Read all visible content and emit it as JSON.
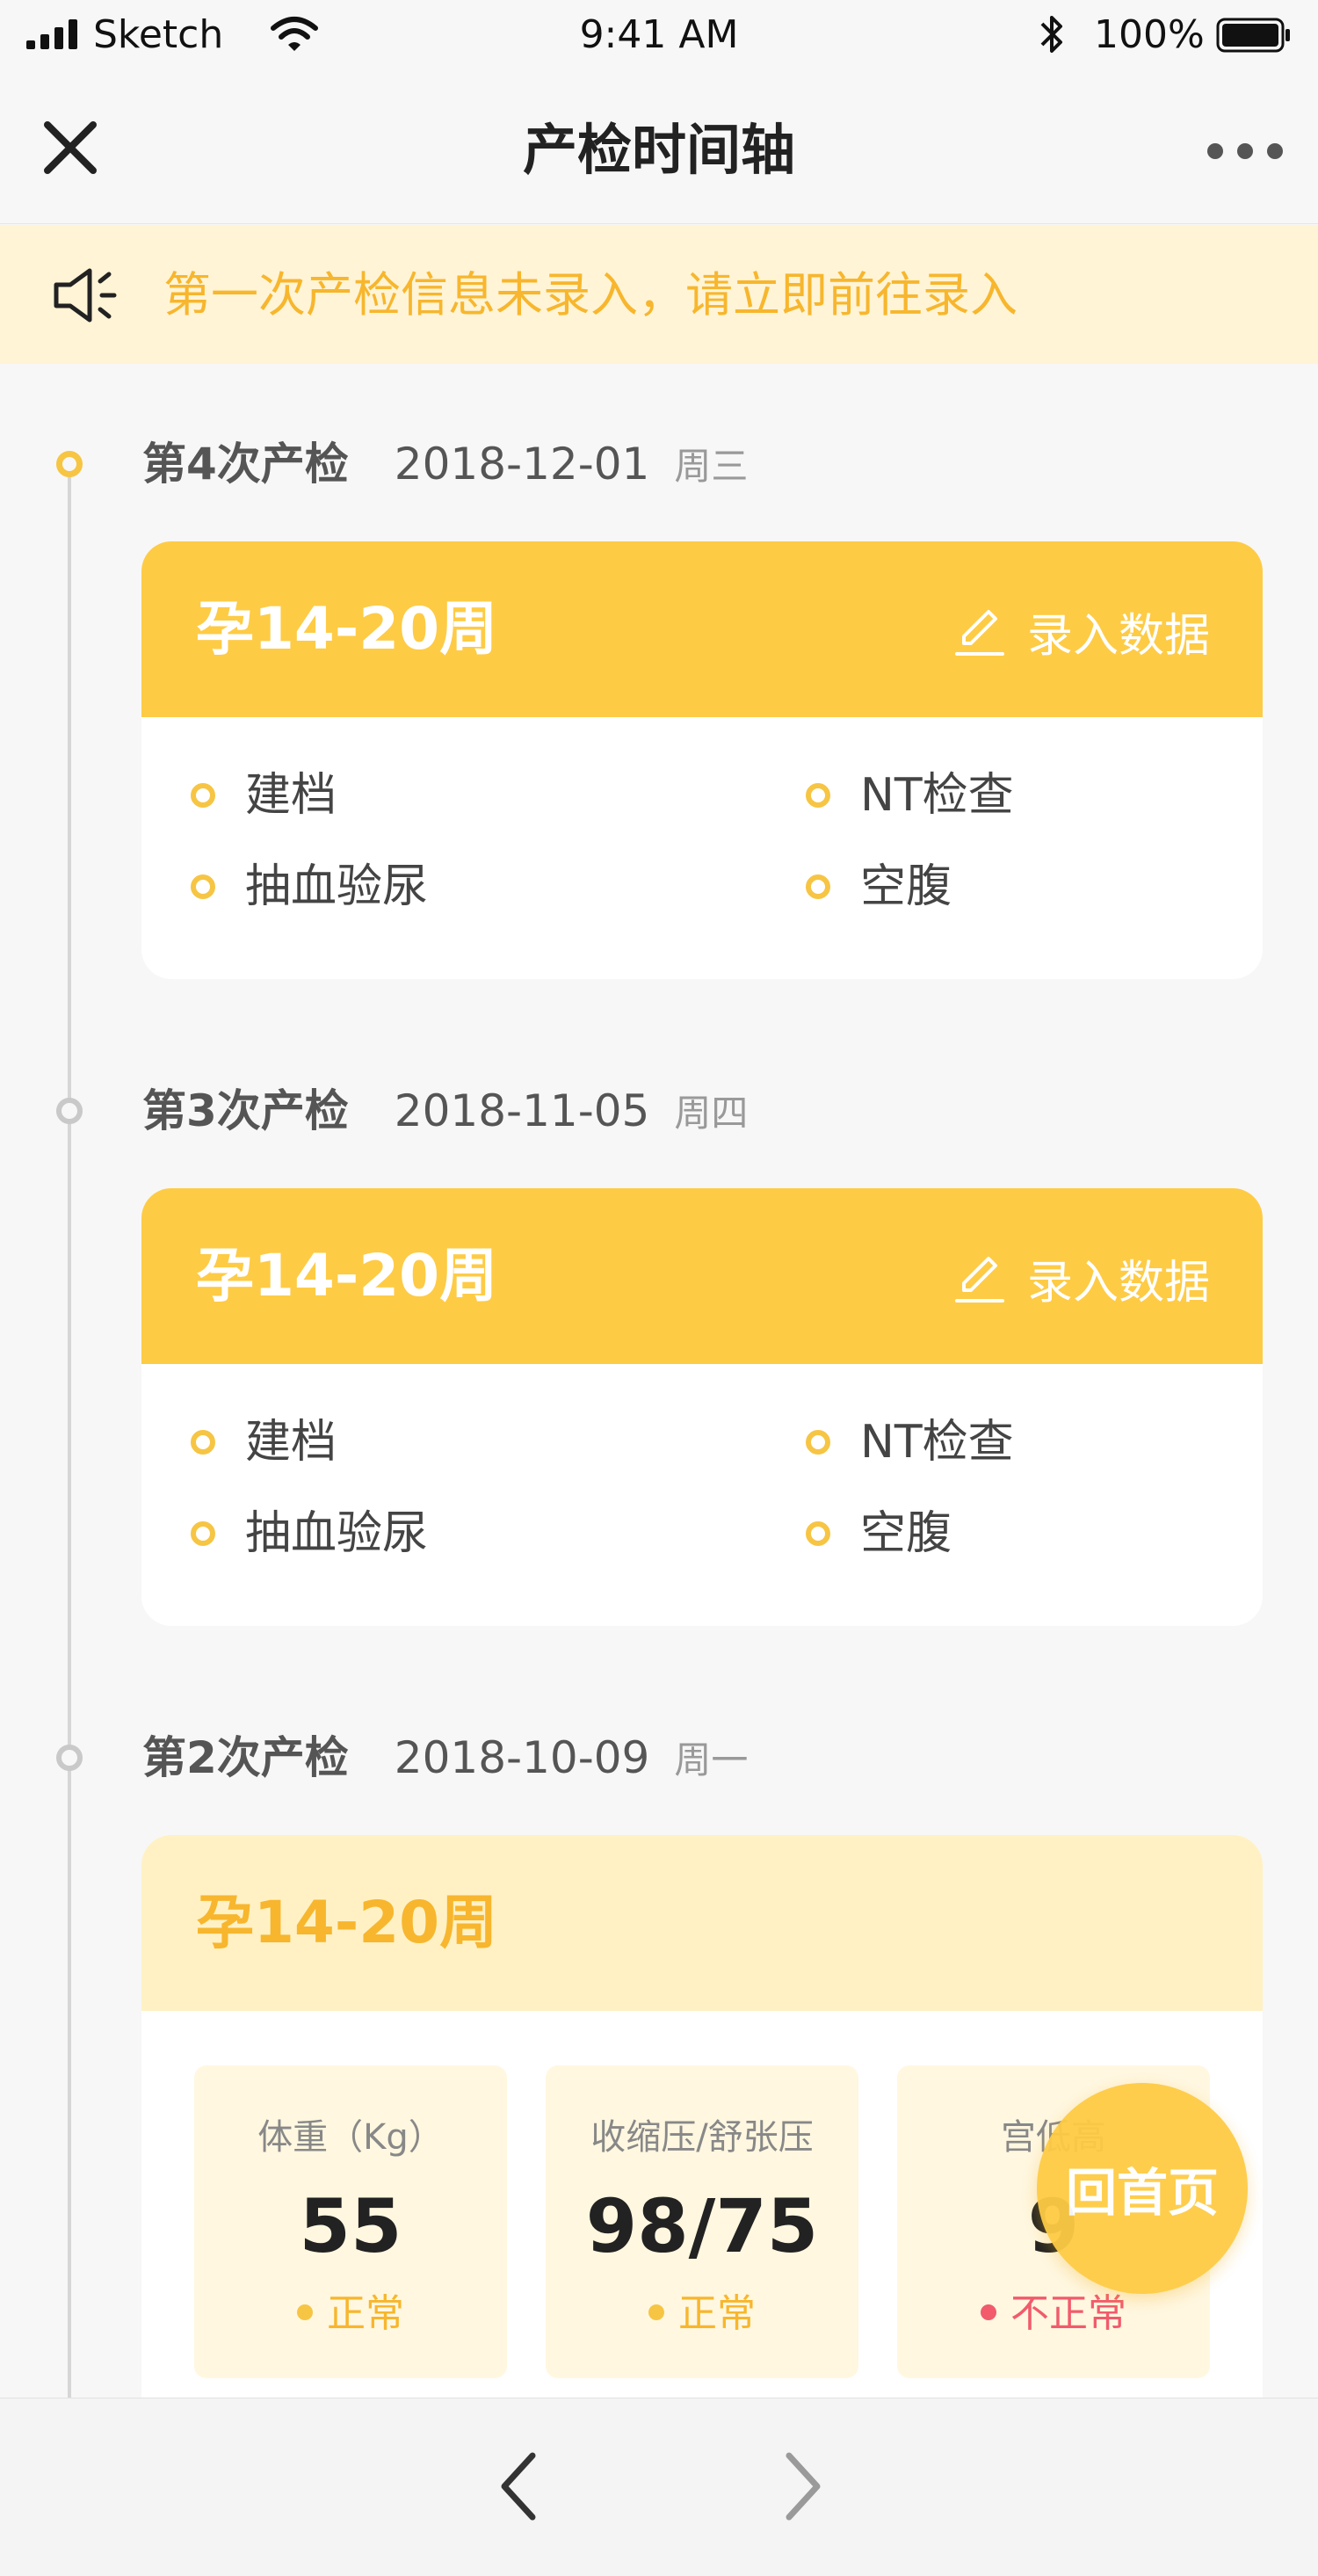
{
  "status_bar": {
    "carrier": "Sketch",
    "time": "9:41 AM",
    "battery": "100%",
    "icons": [
      "signal-icon",
      "wifi-icon",
      "bluetooth-icon",
      "battery-icon"
    ]
  },
  "nav": {
    "title": "产检时间轴",
    "close_icon": "close-icon",
    "more_icon": "more-icon"
  },
  "notice": {
    "icon": "speaker-icon",
    "text": "第一次产检信息未录入，请立即前往录入"
  },
  "timeline": [
    {
      "label": "第4次产检",
      "date": "2018-12-01",
      "weekday": "周三",
      "active": true,
      "card": {
        "title": "孕14-20周",
        "action": "录入数据",
        "items": [
          "建档",
          "NT检查",
          "抽血验尿",
          "空腹"
        ]
      }
    },
    {
      "label": "第3次产检",
      "date": "2018-11-05",
      "weekday": "周四",
      "active": false,
      "card": {
        "title": "孕14-20周",
        "action": "录入数据",
        "items": [
          "建档",
          "NT检查",
          "抽血验尿",
          "空腹"
        ]
      }
    },
    {
      "label": "第2次产检",
      "date": "2018-10-09",
      "weekday": "周一",
      "active": false,
      "card": {
        "title": "孕14-20周",
        "metrics": [
          {
            "label": "体重（Kg）",
            "value": "55",
            "status": "正常"
          },
          {
            "label": "收缩压/舒张压",
            "value": "98/75",
            "status": "正常"
          },
          {
            "label": "宫低高",
            "value": "9",
            "status": "不正常"
          }
        ]
      }
    }
  ],
  "fab": {
    "label": "回首页"
  },
  "bottom": {
    "prev_icon": "chevron-left-icon",
    "next_icon": "chevron-right-icon"
  },
  "colors": {
    "accent": "#fecb45",
    "accent_text": "#f7b62d",
    "notice_bg": "#fff4d6",
    "light_header": "#fff1c4",
    "bad": "#f15b6c"
  }
}
